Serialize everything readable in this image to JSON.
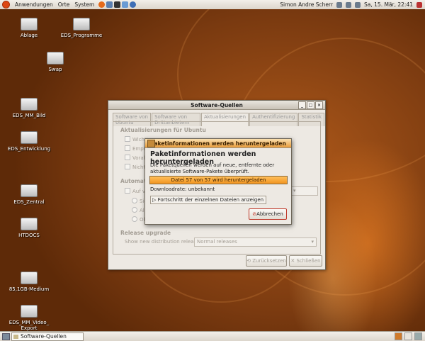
{
  "topbar": {
    "menu": [
      "Anwendungen",
      "Orte",
      "System"
    ],
    "user": "Simon Andre Scherr",
    "clock": "Sa, 15. Mär, 22:41"
  },
  "desktop_icons": [
    {
      "label": "Ablage"
    },
    {
      "label": "EDS_Programme"
    },
    {
      "label": "Swap"
    },
    {
      "label": "EDS_MM_Bild"
    },
    {
      "label": "EDS_Entwicklung"
    },
    {
      "label": "EDS_Zentral"
    },
    {
      "label": "HTDOCS"
    },
    {
      "label": "85,1GB-Medium"
    },
    {
      "label": "EDS_MM_Video_ Export"
    }
  ],
  "main_window": {
    "title": "Software-Quellen",
    "tabs": [
      "Software von Ubuntu",
      "Software von Drittanbietern",
      "Aktualisierungen",
      "Authentifizierung",
      "Statistik"
    ],
    "section_updates": "Aktualisierungen für Ubuntu",
    "update_options": [
      "Wichtig",
      "Empf",
      "Vorab",
      "Nicht u"
    ],
    "section_auto": "Automatisch",
    "auto_check": "Auf ver",
    "auto_radios": [
      "Sich",
      "Alle",
      "Ober"
    ],
    "section_release": "Release upgrade",
    "release_label": "Show new distribution releases:",
    "release_value": "Normal releases",
    "btn_revert": "Zurücksetzen",
    "btn_close": "Schließen"
  },
  "dialog": {
    "title": "Paketinformationen werden heruntergeladen",
    "heading": "Paketinformationen werden heruntergeladen",
    "description": "Die Paketquellen werden auf neue, entfernte oder aktualisierte Software-Pakete überprüft.",
    "progress_text": "Datei 57 von 57 wird heruntergeladen",
    "progress_fraction": 1.0,
    "rate": "Downloadrate: unbekannt",
    "expander": "Fortschritt der einzelnen Dateien anzeigen",
    "cancel": "Abbrechen"
  },
  "taskbar": {
    "item": "Software-Quellen"
  },
  "colors": {
    "accent": "#f29520",
    "desktop": "#8a4413"
  }
}
